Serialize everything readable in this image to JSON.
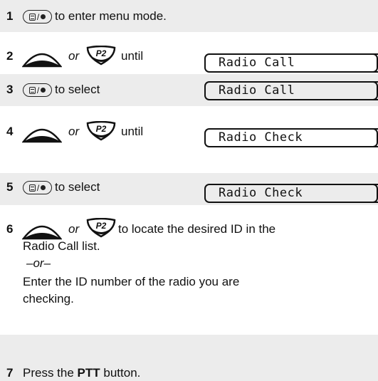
{
  "steps": [
    {
      "num": "1",
      "text": "to enter menu mode."
    },
    {
      "num": "2",
      "or": "or",
      "text": "until",
      "display": "Radio Call"
    },
    {
      "num": "3",
      "text": "to select",
      "display": "Radio Call"
    },
    {
      "num": "4",
      "or": "or",
      "text": "until",
      "display": "Radio Check"
    },
    {
      "num": "5",
      "text": "to select",
      "display": "Radio Check"
    },
    {
      "num": "6",
      "or": "or",
      "text": "to locate the desired ID in the",
      "line2": "Radio Call list.",
      "alt": "–or–",
      "line3": "Enter the ID number of the radio you are",
      "line4": "checking."
    },
    {
      "num": "7",
      "text_pre": "Press the",
      "bold": "PTT",
      "text_post": "button."
    }
  ],
  "icons": {
    "menu_select": "menu-select-button-icon",
    "up_key": "up-arrow-key-icon",
    "p2_key": "p2-key-icon",
    "p2_label": "P2"
  }
}
